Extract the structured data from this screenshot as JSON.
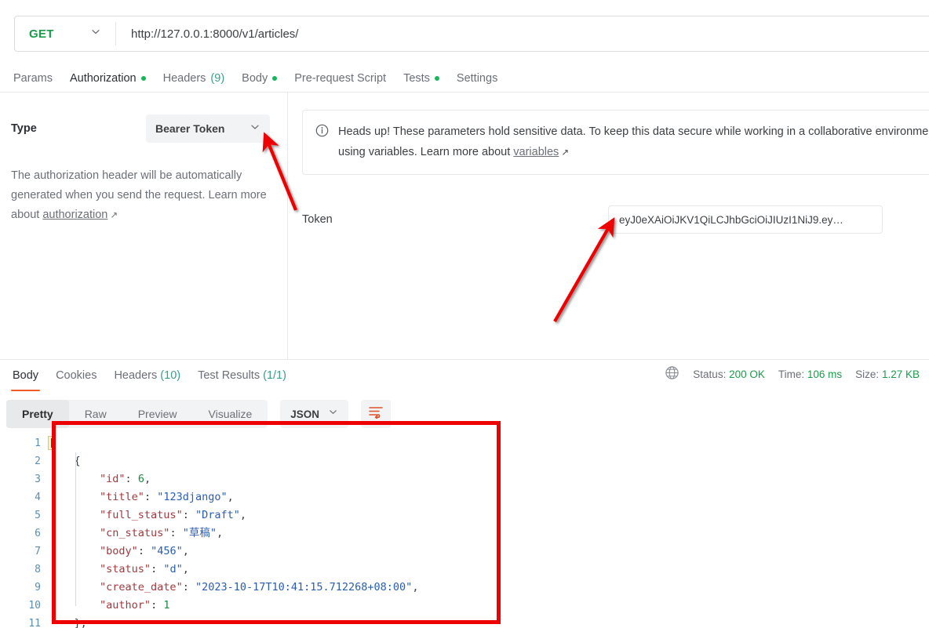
{
  "request": {
    "method": "GET",
    "url": "http://127.0.0.1:8000/v1/articles/",
    "tabs": [
      {
        "label": "Params",
        "badge": "",
        "dot": false,
        "active": false
      },
      {
        "label": "Authorization",
        "badge": "",
        "dot": true,
        "active": true
      },
      {
        "label": "Headers",
        "badge": "(9)",
        "dot": false,
        "active": false
      },
      {
        "label": "Body",
        "badge": "",
        "dot": true,
        "active": false
      },
      {
        "label": "Pre-request Script",
        "badge": "",
        "dot": false,
        "active": false
      },
      {
        "label": "Tests",
        "badge": "",
        "dot": true,
        "active": false
      },
      {
        "label": "Settings",
        "badge": "",
        "dot": false,
        "active": false
      }
    ]
  },
  "auth": {
    "type_label": "Type",
    "type_value": "Bearer Token",
    "description_part1": "The authorization header will be automatically generated when you send the request. Learn more about ",
    "description_link": "authorization",
    "notice_text_part1": "Heads up! These parameters hold sensitive data. To keep this data secure while working in a collaborative environment, we recommend using variables. Learn more about ",
    "notice_link": "variables",
    "token_label": "Token",
    "token_value": "eyJ0eXAiOiJKV1QiLCJhbGciOiJIUzI1NiJ9.ey…",
    "token_placeholder": "Token"
  },
  "response": {
    "tabs": [
      {
        "label": "Body",
        "badge": "",
        "active": true
      },
      {
        "label": "Cookies",
        "badge": "",
        "active": false
      },
      {
        "label": "Headers",
        "badge": "(10)",
        "active": false
      },
      {
        "label": "Test Results",
        "badge": "(1/1)",
        "active": false
      }
    ],
    "meta": {
      "status_label": "Status:",
      "status_value": "200 OK",
      "time_label": "Time:",
      "time_value": "106 ms",
      "size_label": "Size:",
      "size_value": "1.27 KB"
    },
    "view_modes": [
      {
        "label": "Pretty",
        "active": true
      },
      {
        "label": "Raw",
        "active": false
      },
      {
        "label": "Preview",
        "active": false
      },
      {
        "label": "Visualize",
        "active": false
      }
    ],
    "format": "JSON",
    "wrap_tooltip": "Wrap Line",
    "line_numbers": [
      "1",
      "2",
      "3",
      "4",
      "5",
      "6",
      "7",
      "8",
      "9",
      "10",
      "11"
    ],
    "code_lines": [
      [
        {
          "t": "[",
          "c": "p",
          "hl": true
        }
      ],
      [
        {
          "t": "    {",
          "c": "p"
        }
      ],
      [
        {
          "t": "        ",
          "c": "p"
        },
        {
          "t": "\"id\"",
          "c": "k"
        },
        {
          "t": ": ",
          "c": "p"
        },
        {
          "t": "6",
          "c": "n"
        },
        {
          "t": ",",
          "c": "p"
        }
      ],
      [
        {
          "t": "        ",
          "c": "p"
        },
        {
          "t": "\"title\"",
          "c": "k"
        },
        {
          "t": ": ",
          "c": "p"
        },
        {
          "t": "\"123django\"",
          "c": "s"
        },
        {
          "t": ",",
          "c": "p"
        }
      ],
      [
        {
          "t": "        ",
          "c": "p"
        },
        {
          "t": "\"full_status\"",
          "c": "k"
        },
        {
          "t": ": ",
          "c": "p"
        },
        {
          "t": "\"Draft\"",
          "c": "s"
        },
        {
          "t": ",",
          "c": "p"
        }
      ],
      [
        {
          "t": "        ",
          "c": "p"
        },
        {
          "t": "\"cn_status\"",
          "c": "k"
        },
        {
          "t": ": ",
          "c": "p"
        },
        {
          "t": "\"草稿\"",
          "c": "s"
        },
        {
          "t": ",",
          "c": "p"
        }
      ],
      [
        {
          "t": "        ",
          "c": "p"
        },
        {
          "t": "\"body\"",
          "c": "k"
        },
        {
          "t": ": ",
          "c": "p"
        },
        {
          "t": "\"456\"",
          "c": "s"
        },
        {
          "t": ",",
          "c": "p"
        }
      ],
      [
        {
          "t": "        ",
          "c": "p"
        },
        {
          "t": "\"status\"",
          "c": "k"
        },
        {
          "t": ": ",
          "c": "p"
        },
        {
          "t": "\"d\"",
          "c": "s"
        },
        {
          "t": ",",
          "c": "p"
        }
      ],
      [
        {
          "t": "        ",
          "c": "p"
        },
        {
          "t": "\"create_date\"",
          "c": "k"
        },
        {
          "t": ": ",
          "c": "p"
        },
        {
          "t": "\"2023-10-17T10:41:15.712268+08:00\"",
          "c": "s"
        },
        {
          "t": ",",
          "c": "p"
        }
      ],
      [
        {
          "t": "        ",
          "c": "p"
        },
        {
          "t": "\"author\"",
          "c": "k"
        },
        {
          "t": ": ",
          "c": "p"
        },
        {
          "t": "1",
          "c": "n"
        }
      ],
      [
        {
          "t": "    },",
          "c": "p"
        }
      ]
    ]
  },
  "annotations": {
    "highlight_box_color": "#ee0000",
    "arrow_color": "#ee0000",
    "arrow_1_target": "bearer-token-dropdown",
    "arrow_2_target": "token-input-field"
  },
  "colors": {
    "accent": "#ef5b25",
    "method_get": "#1a9c4b",
    "status_ok": "#1a9c4b",
    "annotation_red": "#ee0000"
  }
}
